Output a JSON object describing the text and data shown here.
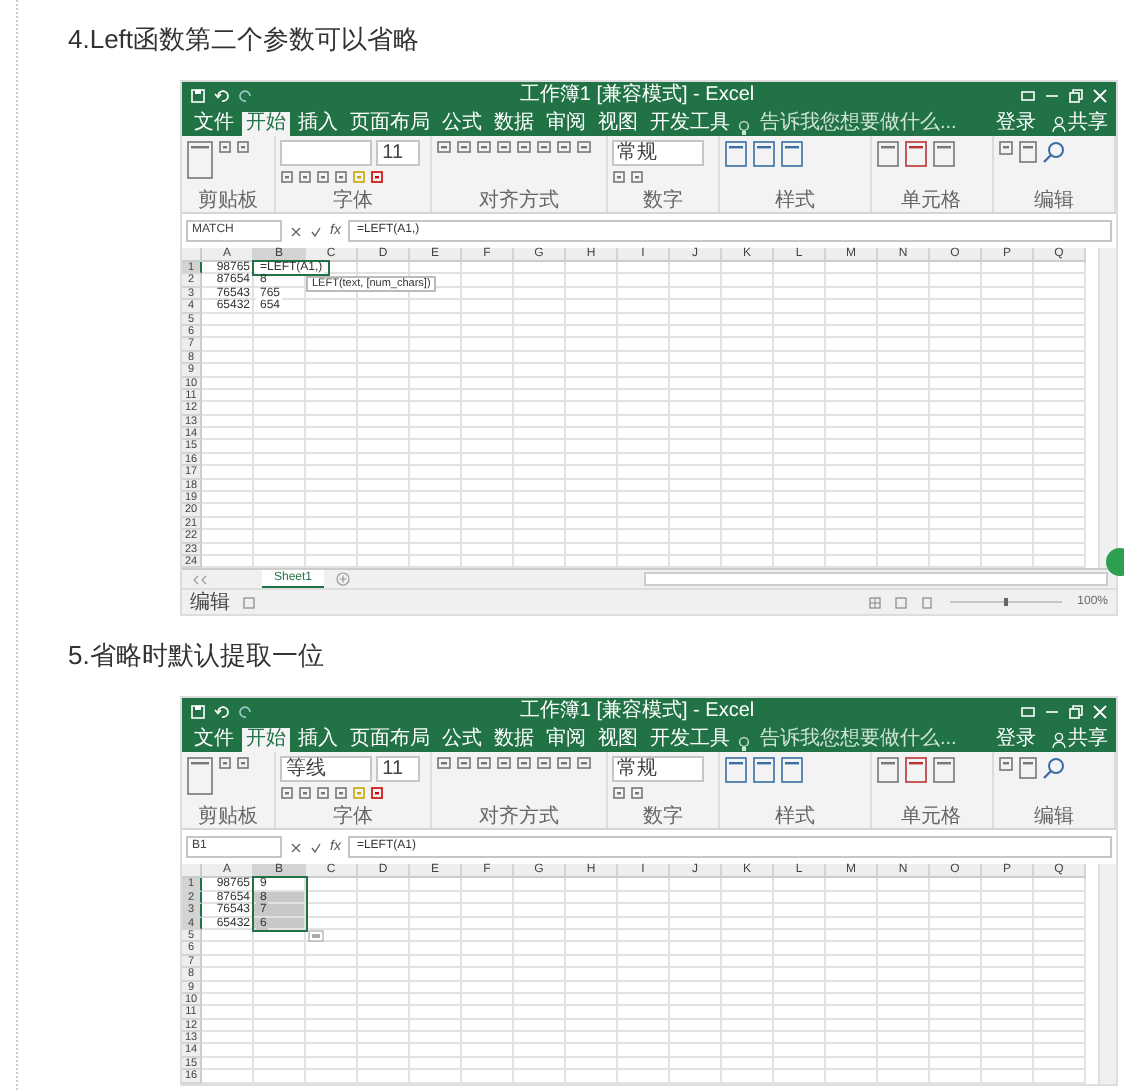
{
  "sections": [
    {
      "heading": "4.Left函数第二个参数可以省略",
      "excel": {
        "title": "工作簿1 [兼容模式] - Excel",
        "tabs": [
          {
            "label": "文件",
            "selected": false
          },
          {
            "label": "开始",
            "selected": true
          },
          {
            "label": "插入",
            "selected": false
          },
          {
            "label": "页面布局",
            "selected": false
          },
          {
            "label": "公式",
            "selected": false
          },
          {
            "label": "数据",
            "selected": false
          },
          {
            "label": "审阅",
            "selected": false
          },
          {
            "label": "视图",
            "selected": false
          },
          {
            "label": "开发工具",
            "selected": false
          }
        ],
        "tell_me": "告诉我您想要做什么...",
        "sign_in": "登录",
        "share": "共享",
        "font_size": "11",
        "number_format": "常规",
        "groups": [
          "剪贴板",
          "字体",
          "对齐方式",
          "数字",
          "样式",
          "单元格",
          "编辑"
        ],
        "name_box": "MATCH",
        "function_label": "fx",
        "formula": "=LEFT(A1,)",
        "tooltip": "LEFT(text, [num_chars])",
        "columns": [
          {
            "label": "A",
            "selected": false
          },
          {
            "label": "B",
            "selected": true
          },
          {
            "label": "C",
            "selected": false
          },
          {
            "label": "D",
            "selected": false
          },
          {
            "label": "E",
            "selected": false
          },
          {
            "label": "F",
            "selected": false
          },
          {
            "label": "G",
            "selected": false
          },
          {
            "label": "H",
            "selected": false
          },
          {
            "label": "I",
            "selected": false
          },
          {
            "label": "J",
            "selected": false
          },
          {
            "label": "K",
            "selected": false
          },
          {
            "label": "L",
            "selected": false
          },
          {
            "label": "M",
            "selected": false
          },
          {
            "label": "N",
            "selected": false
          },
          {
            "label": "O",
            "selected": false
          },
          {
            "label": "P",
            "selected": false
          },
          {
            "label": "Q",
            "selected": false
          }
        ],
        "rows": [
          {
            "number": "1",
            "a": "98765",
            "b": "=LEFT(A1,)",
            "selected": true,
            "shaded": false
          },
          {
            "number": "2",
            "a": "87654",
            "b": "8",
            "selected": false,
            "shaded": false
          },
          {
            "number": "3",
            "a": "76543",
            "b": "765",
            "selected": false,
            "shaded": false
          },
          {
            "number": "4",
            "a": "65432",
            "b": "654",
            "selected": false,
            "shaded": false
          },
          {
            "number": "5",
            "selected": false,
            "shaded": false
          },
          {
            "number": "6",
            "selected": false,
            "shaded": false
          },
          {
            "number": "7",
            "selected": false,
            "shaded": false
          },
          {
            "number": "8",
            "selected": false,
            "shaded": false
          },
          {
            "number": "9",
            "selected": false,
            "shaded": false
          },
          {
            "number": "10",
            "selected": false,
            "shaded": false
          },
          {
            "number": "11",
            "selected": false,
            "shaded": false
          },
          {
            "number": "12",
            "selected": false,
            "shaded": false
          },
          {
            "number": "13",
            "selected": false,
            "shaded": false
          },
          {
            "number": "14",
            "selected": false,
            "shaded": false
          },
          {
            "number": "15",
            "selected": false,
            "shaded": false
          },
          {
            "number": "16",
            "selected": false,
            "shaded": false
          },
          {
            "number": "17",
            "selected": false,
            "shaded": false
          },
          {
            "number": "18",
            "selected": false,
            "shaded": false
          },
          {
            "number": "19",
            "selected": false,
            "shaded": false
          },
          {
            "number": "20",
            "selected": false,
            "shaded": false
          },
          {
            "number": "21",
            "selected": false,
            "shaded": false
          },
          {
            "number": "22",
            "selected": false,
            "shaded": false
          },
          {
            "number": "23",
            "selected": false,
            "shaded": false
          },
          {
            "number": "24",
            "selected": false,
            "shaded": false
          }
        ],
        "sheet_tab": "Sheet1",
        "status": "编辑",
        "zoom": "100%"
      }
    },
    {
      "heading": "5.省略时默认提取一位",
      "excel": {
        "title": "工作簿1 [兼容模式] - Excel",
        "tabs": [
          {
            "label": "文件",
            "selected": false
          },
          {
            "label": "开始",
            "selected": true
          },
          {
            "label": "插入",
            "selected": false
          },
          {
            "label": "页面布局",
            "selected": false
          },
          {
            "label": "公式",
            "selected": false
          },
          {
            "label": "数据",
            "selected": false
          },
          {
            "label": "审阅",
            "selected": false
          },
          {
            "label": "视图",
            "selected": false
          },
          {
            "label": "开发工具",
            "selected": false
          }
        ],
        "tell_me": "告诉我您想要做什么...",
        "sign_in": "登录",
        "share": "共享",
        "font_name": "等线",
        "font_size": "11",
        "number_format": "常规",
        "groups": [
          "剪贴板",
          "字体",
          "对齐方式",
          "数字",
          "样式",
          "单元格",
          "编辑"
        ],
        "name_box": "B1",
        "function_label": "fx",
        "formula": "=LEFT(A1)",
        "fill_handle": true,
        "columns": [
          {
            "label": "A",
            "selected": false
          },
          {
            "label": "B",
            "selected": true
          },
          {
            "label": "C",
            "selected": false
          },
          {
            "label": "D",
            "selected": false
          },
          {
            "label": "E",
            "selected": false
          },
          {
            "label": "F",
            "selected": false
          },
          {
            "label": "G",
            "selected": false
          },
          {
            "label": "H",
            "selected": false
          },
          {
            "label": "I",
            "selected": false
          },
          {
            "label": "J",
            "selected": false
          },
          {
            "label": "K",
            "selected": false
          },
          {
            "label": "L",
            "selected": false
          },
          {
            "label": "M",
            "selected": false
          },
          {
            "label": "N",
            "selected": false
          },
          {
            "label": "O",
            "selected": false
          },
          {
            "label": "P",
            "selected": false
          },
          {
            "label": "Q",
            "selected": false
          }
        ],
        "rows": [
          {
            "number": "1",
            "a": "98765",
            "b": "9",
            "selected": true,
            "shaded": false
          },
          {
            "number": "2",
            "a": "87654",
            "b": "8",
            "selected": true,
            "shaded": true
          },
          {
            "number": "3",
            "a": "76543",
            "b": "7",
            "selected": true,
            "shaded": true
          },
          {
            "number": "4",
            "a": "65432",
            "b": "6",
            "selected": true,
            "shaded": true
          },
          {
            "number": "5",
            "selected": false,
            "shaded": false
          },
          {
            "number": "6",
            "selected": false,
            "shaded": false
          },
          {
            "number": "7",
            "selected": false,
            "shaded": false
          },
          {
            "number": "8",
            "selected": false,
            "shaded": false
          },
          {
            "number": "9",
            "selected": false,
            "shaded": false
          },
          {
            "number": "10",
            "selected": false,
            "shaded": false
          },
          {
            "number": "11",
            "selected": false,
            "shaded": false
          },
          {
            "number": "12",
            "selected": false,
            "shaded": false
          },
          {
            "number": "13",
            "selected": false,
            "shaded": false
          },
          {
            "number": "14",
            "selected": false,
            "shaded": false
          },
          {
            "number": "15",
            "selected": false,
            "shaded": false
          },
          {
            "number": "16",
            "selected": false,
            "shaded": false
          }
        ]
      }
    }
  ]
}
